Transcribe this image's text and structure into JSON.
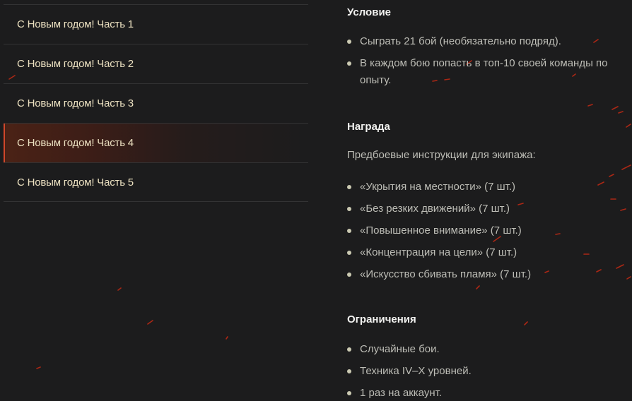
{
  "sidebar": {
    "items": [
      {
        "label": "С Новым годом! Часть 1"
      },
      {
        "label": "С Новым годом! Часть 2"
      },
      {
        "label": "С Новым годом! Часть 3"
      },
      {
        "label": "С Новым годом! Часть 4",
        "active": true
      },
      {
        "label": "С Новым годом! Часть 5"
      }
    ]
  },
  "condition": {
    "title": "Условие",
    "items": [
      "Сыграть 21 бой (необязательно подряд).",
      "В каждом бою попасть в топ-10 своей команды по опыту."
    ]
  },
  "reward": {
    "title": "Награда",
    "intro": "Предбоевые инструкции для экипажа:",
    "items": [
      "«Укрытия на местности» (7 шт.)",
      "«Без резких движений» (7 шт.)",
      "«Повышенное внимание» (7 шт.)",
      "«Концентрация на цели» (7 шт.)",
      "«Искусство сбивать пламя» (7 шт.)"
    ]
  },
  "restrictions": {
    "title": "Ограничения",
    "items": [
      "Случайные бои.",
      "Техника IV–X уровней.",
      "1 раз на аккаунт."
    ]
  },
  "colors": {
    "background": "#1c1c1d",
    "active_accent": "#d2472a",
    "sidebar_text": "#ece1c1",
    "body_text": "#bdbdb6",
    "spark": "#c42a14"
  }
}
